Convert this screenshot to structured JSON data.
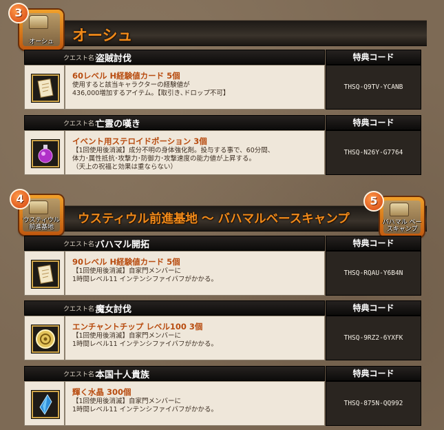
{
  "sections": [
    {
      "number": "3",
      "badge_label": "オーシュ",
      "area_title": "オーシュ"
    },
    {
      "number": "4",
      "badge_label": "ウスティウル\n前進基地",
      "area_title": "ウスティウル前進基地 ～ バハマルベースキャンプ",
      "number_right": "5",
      "badge_label_right": "バハマル\nベースキャンプ"
    }
  ],
  "labels": {
    "quest_label": "クエスト名：",
    "code_header": "特典コード"
  },
  "quests": [
    {
      "name": "盗賊討伐",
      "item_name": "60レベル H経験値カード 5個",
      "item_desc": "使用すると該当キャラクターの経験値が\n436,000増加するアイテム。【取引き､ドロップ不可】",
      "code": "THSQ-Q9TV-YCANB",
      "icon": "exp-card-icon"
    },
    {
      "name": "亡霊の嘆き",
      "item_name": "イベント用ステロイドポーション 3個",
      "item_desc": "【1回使用後消滅】成分不明の身体強化剤。投与する事で、60分間、\n体力･属性抵抗･攻撃力･防御力･攻撃速度の能力値が上昇する。\n（天上の祝福と効果は重ならない）",
      "code": "THSQ-N26Y-G7764",
      "icon": "potion-icon"
    },
    {
      "name": "バハマル開拓",
      "item_name": "90レベル H経験値カード 5個",
      "item_desc": "【1回使用後消滅】自家門メンバーに\n1時間レベル11 インテンシファイバフがかかる。",
      "code": "THSQ-RQAU-Y6B4N",
      "icon": "exp-card-icon"
    },
    {
      "name": "魔女討伐",
      "item_name": "エンチャントチップ レベル100 3個",
      "item_desc": "【1回使用後消滅】自家門メンバーに\n1時間レベル11 インテンシファイバフがかかる。",
      "code": "THSQ-9RZ2-6YXFK",
      "icon": "enchant-chip-icon"
    },
    {
      "name": "本国十人貴族",
      "item_name": "輝く水晶 300個",
      "item_desc": "【1回使用後消滅】自家門メンバーに\n1時間レベル11 インテンシファイバフがかかる。",
      "code": "THSQ-875N-QQ992",
      "icon": "crystal-icon"
    }
  ]
}
